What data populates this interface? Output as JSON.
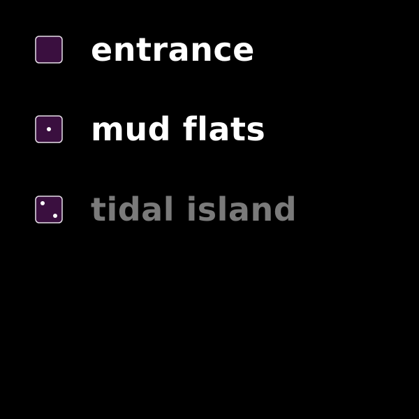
{
  "menu": {
    "items": [
      {
        "label": "entrance",
        "icon": "die-face-blank-icon",
        "enabled": true
      },
      {
        "label": "mud flats",
        "icon": "die-face-one-icon",
        "enabled": true
      },
      {
        "label": "tidal island",
        "icon": "die-face-two-icon",
        "enabled": false
      }
    ]
  },
  "colors": {
    "background": "#000000",
    "die_fill": "#3a0f3f",
    "die_border": "#e8e0ea",
    "label_enabled": "#ffffff",
    "label_disabled": "#7a7a7a"
  }
}
